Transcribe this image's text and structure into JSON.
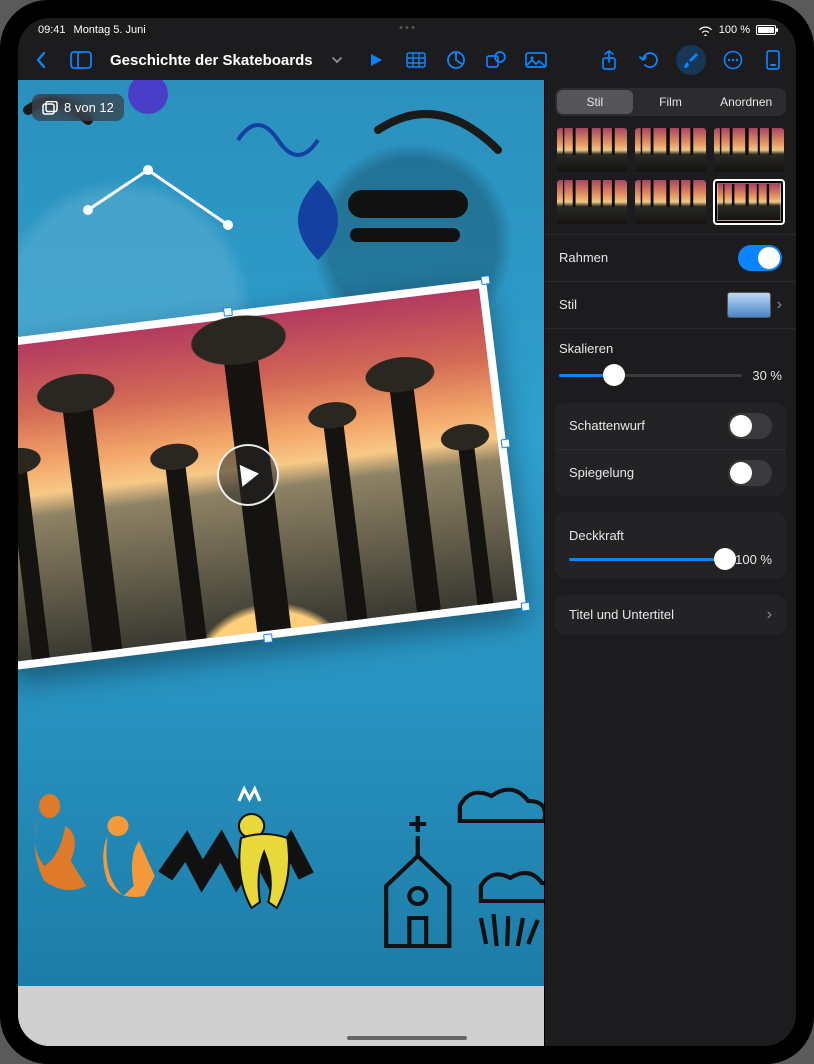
{
  "status": {
    "time": "09:41",
    "date": "Montag 5. Juni",
    "battery_pct": "100 %"
  },
  "toolbar": {
    "title": "Geschichte der Skateboards"
  },
  "slide_counter": "8 von 12",
  "inspector": {
    "tabs": {
      "style": "Stil",
      "film": "Film",
      "arrange": "Anordnen"
    },
    "frame": {
      "label": "Rahmen",
      "enabled": true,
      "style_label": "Stil",
      "scale_label": "Skalieren",
      "scale_value": "30 %",
      "scale_pct": 30
    },
    "shadow": {
      "label": "Schattenwurf",
      "enabled": false
    },
    "reflection": {
      "label": "Spiegelung",
      "enabled": false
    },
    "opacity": {
      "label": "Deckkraft",
      "value": "100 %",
      "pct": 100
    },
    "title_subtitle": "Titel und Untertitel"
  }
}
